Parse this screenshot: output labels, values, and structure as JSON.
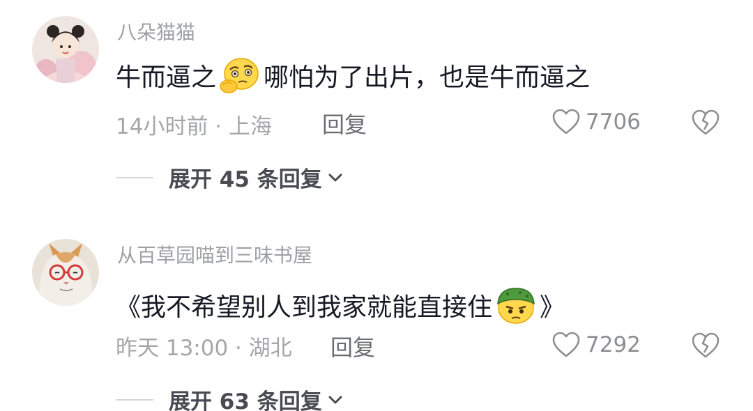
{
  "comments": [
    {
      "username": "八朵猫猫",
      "text_before_emoji": "牛而逼之",
      "emoji": "thinking-face-emoji",
      "text_after_emoji": "哪怕为了出片，也是牛而逼之",
      "meta": "14小时前 · 上海",
      "reply_label": "回复",
      "likes": "7706",
      "expand_label": "展开 45 条回复"
    },
    {
      "username": "从百草园喵到三味书屋",
      "text_before_emoji": "《我不希望别人到我家就能直接住",
      "emoji": "soldier-helmet-emoji",
      "text_after_emoji": "》",
      "meta": "昨天 13:00 · 湖北",
      "reply_label": "回复",
      "likes": "7292",
      "expand_label": "展开 63 条回复"
    }
  ],
  "colors": {
    "username": "#9fa0a6",
    "body_text": "#161823",
    "meta": "#a5a6ab",
    "expand": "#4a4b52"
  }
}
